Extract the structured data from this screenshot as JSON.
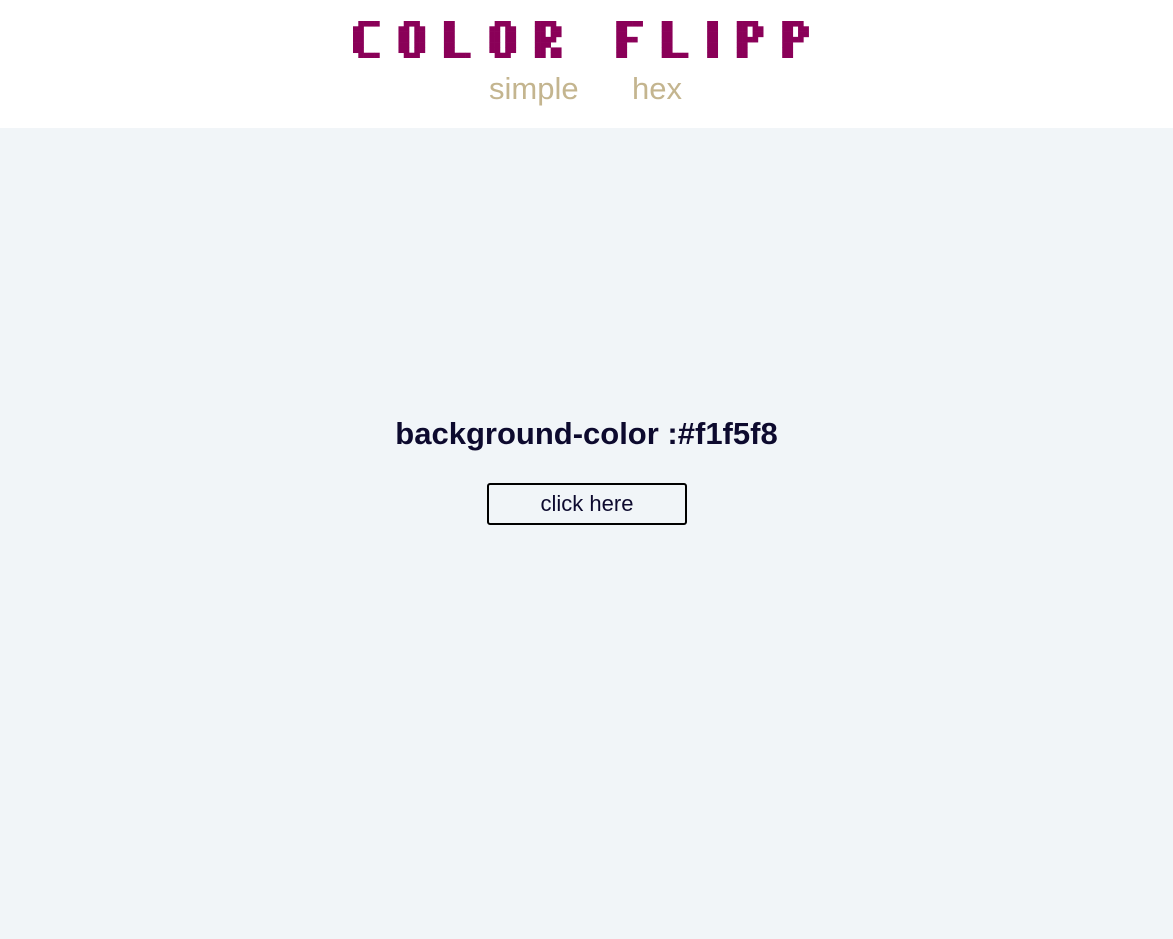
{
  "header": {
    "logo_text": "COLOR FLIPPER",
    "nav": [
      {
        "label": "simple"
      },
      {
        "label": "hex"
      }
    ]
  },
  "main": {
    "label_prefix": "background-color :",
    "current_color": "#f1f5f8",
    "button_label": "click here"
  },
  "colors": {
    "logo": "#8a0058",
    "nav_link": "#c4b58f",
    "text": "#0d0a2e",
    "header_bg": "#ffffff"
  }
}
